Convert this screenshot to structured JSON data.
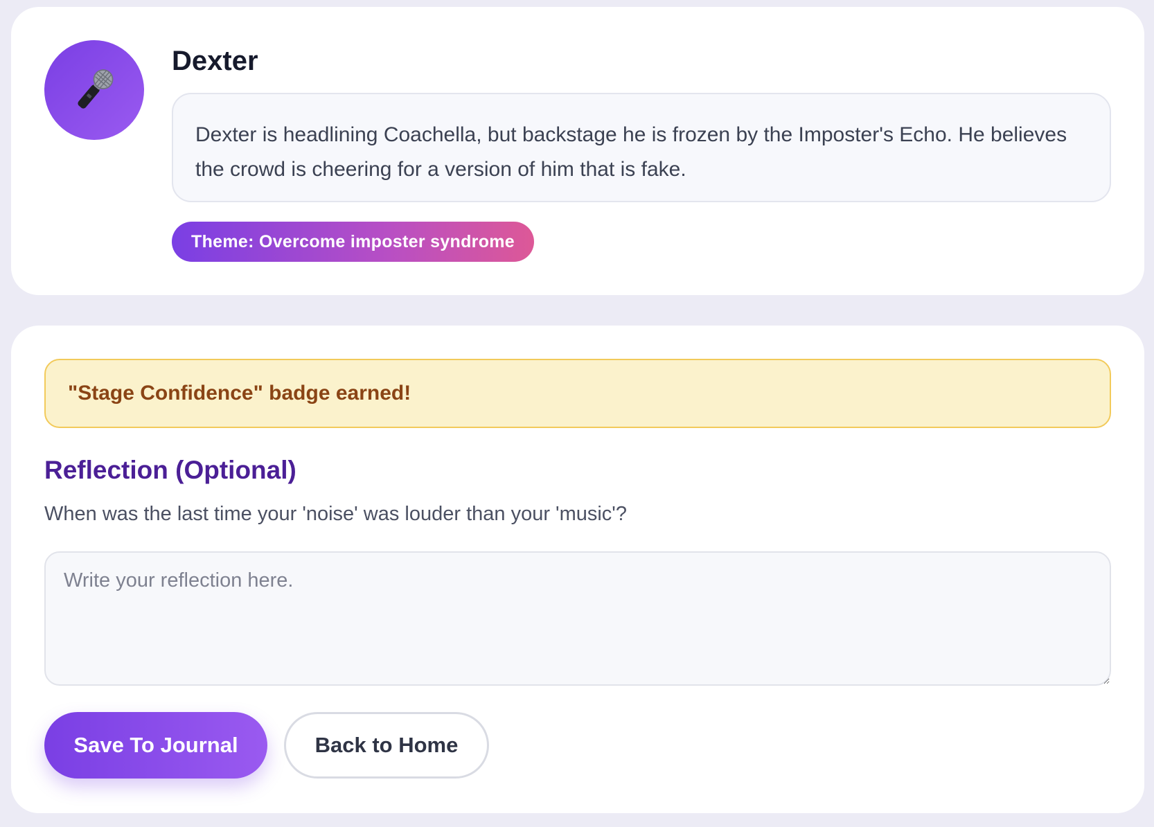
{
  "character": {
    "name": "Dexter",
    "avatar_icon": "microphone-icon",
    "story": "Dexter is headlining Coachella, but backstage he is frozen by the Imposter's Echo. He believes the crowd is cheering for a version of him that is fake.",
    "theme_label": "Theme: Overcome imposter syndrome"
  },
  "badge": {
    "message": "\"Stage Confidence\" badge earned!"
  },
  "reflection": {
    "title": "Reflection (Optional)",
    "question": "When was the last time your 'noise' was louder than your 'music'?",
    "placeholder": "Write your reflection here.",
    "value": ""
  },
  "actions": {
    "save_label": "Save To Journal",
    "home_label": "Back to Home"
  },
  "colors": {
    "accent": "#7a3fe4",
    "accent_end": "#dd5897",
    "badge_bg": "#fbf2cc",
    "badge_text": "#8a4415",
    "heading": "#4b1f96"
  }
}
